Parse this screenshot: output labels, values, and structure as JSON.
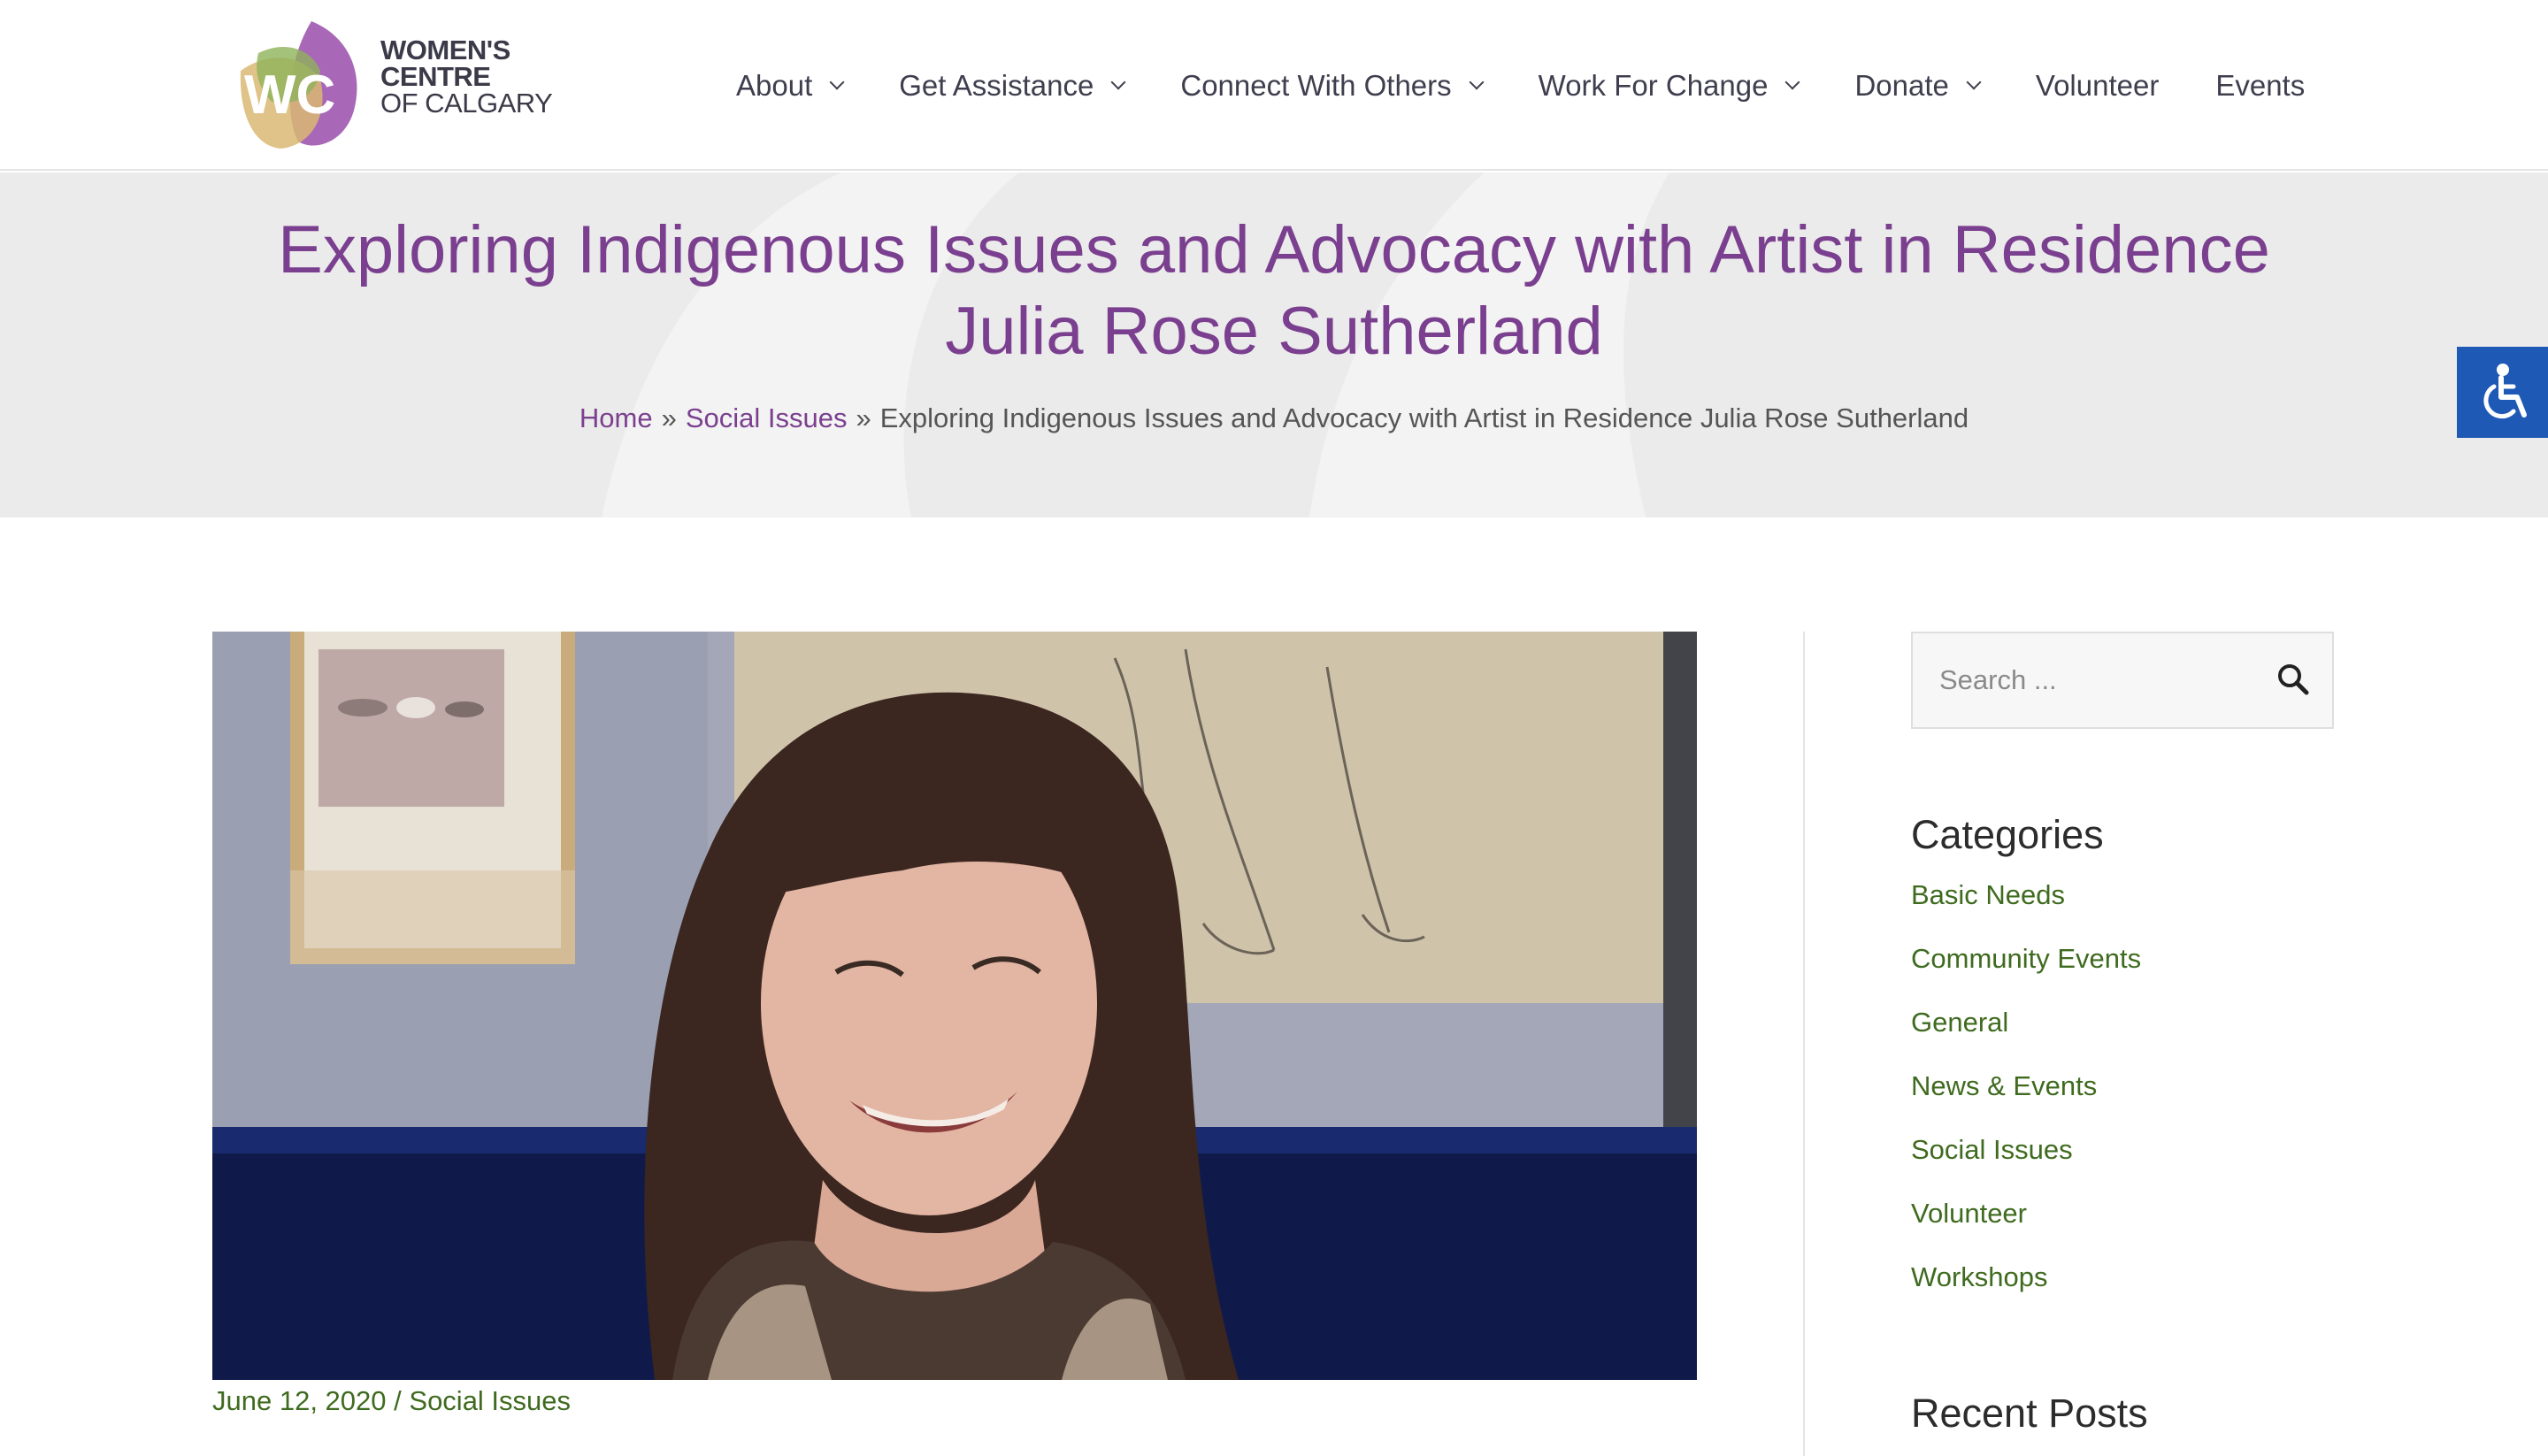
{
  "brand": {
    "line1": "WOMEN'S",
    "line2": "CENTRE",
    "line3": "OF CALGARY",
    "mark_letters": "WC",
    "colors": {
      "purple": "#a35fb3",
      "green": "#8fb35a",
      "gold": "#d9b873"
    }
  },
  "nav": {
    "items": [
      {
        "label": "About",
        "has_dropdown": true
      },
      {
        "label": "Get Assistance",
        "has_dropdown": true
      },
      {
        "label": "Connect With Others",
        "has_dropdown": true
      },
      {
        "label": "Work For Change",
        "has_dropdown": true
      },
      {
        "label": "Donate",
        "has_dropdown": true
      },
      {
        "label": "Volunteer",
        "has_dropdown": false
      },
      {
        "label": "Events",
        "has_dropdown": false
      }
    ]
  },
  "hero": {
    "title_line1": "Exploring Indigenous Issues and Advocacy with Artist in Residence",
    "title_line2": "Julia Rose Sutherland",
    "breadcrumb": {
      "home": "Home",
      "separator": "»",
      "category": "Social Issues",
      "current": "Exploring Indigenous Issues and Advocacy with Artist in Residence Julia Rose Sutherland"
    }
  },
  "accessibility": {
    "icon": "accessibility-icon"
  },
  "post": {
    "date": "June 12, 2020",
    "meta_separator": "/",
    "category": "Social Issues"
  },
  "sidebar": {
    "search": {
      "placeholder": "Search ..."
    },
    "categories_title": "Categories",
    "categories": [
      "Basic Needs",
      "Community Events",
      "General",
      "News & Events",
      "Social Issues",
      "Volunteer",
      "Workshops"
    ],
    "recent_posts_title": "Recent Posts"
  },
  "colors": {
    "title_purple": "#7b3f8f",
    "link_green": "#3f6b1f",
    "a11y_blue": "#1f59b6",
    "hero_bg": "#ebebeb"
  }
}
